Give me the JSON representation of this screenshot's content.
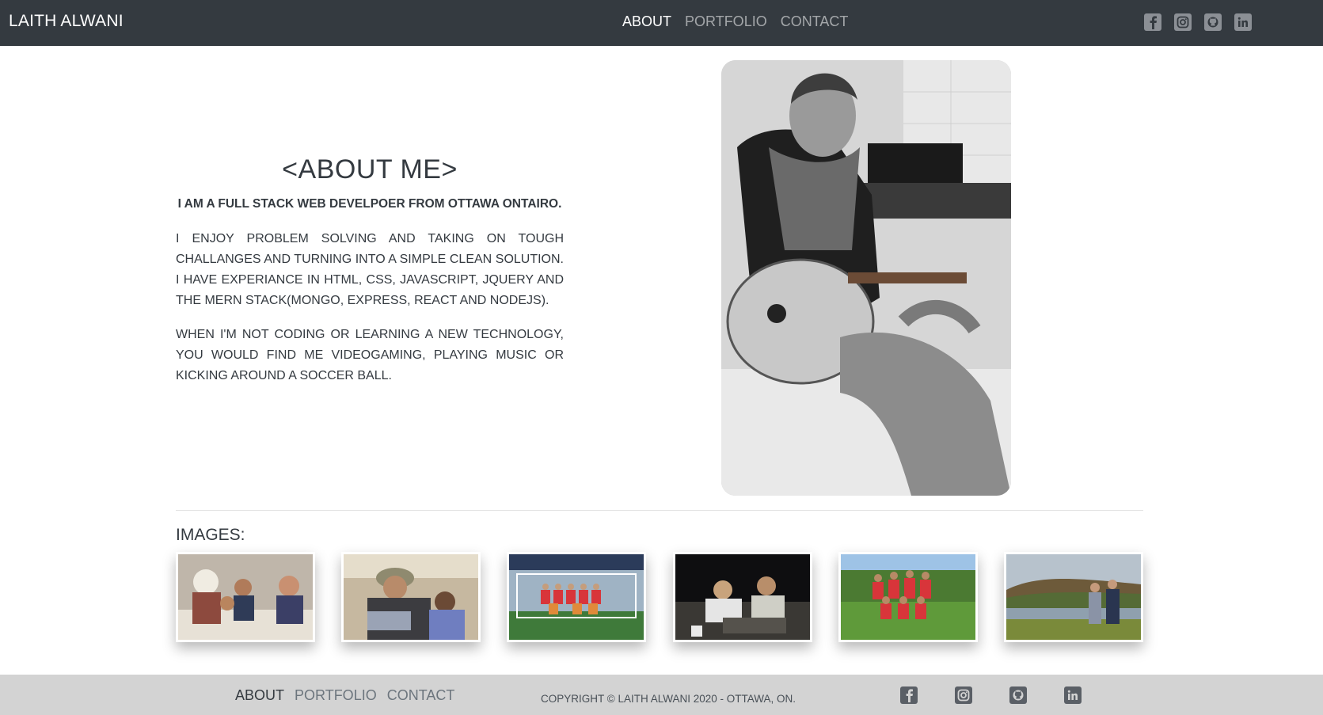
{
  "nav": {
    "brand": "LAITH ALWANI",
    "links": [
      "ABOUT",
      "PORTFOLIO",
      "CONTACT"
    ],
    "icons": [
      "facebook-icon",
      "instagram-icon",
      "github-icon",
      "linkedin-icon"
    ]
  },
  "about": {
    "title": "<ABOUT ME>",
    "subtitle": "I AM A FULL STACK WEB DEVELPOER FROM OTTAWA ONTAIRO.",
    "paragraph1": "I ENJOY PROBLEM SOLVING AND TAKING ON TOUGH CHALLANGES AND TURNING INTO A SIMPLE CLEAN SOLUTION. I HAVE EXPERIANCE IN HTML, CSS, JAVASCRIPT, JQUERY AND THE MERN STACK(MONGO, EXPRESS, REACT AND NODEJS).",
    "paragraph2": "WHEN I'M NOT CODING OR LEARNING A NEW TECHNOLOGY, YOU WOULD FIND ME VIDEOGAMING, PLAYING MUSIC OR KICKING AROUND A SOCCER BALL."
  },
  "gallery": {
    "label": "IMAGES:"
  },
  "footer": {
    "links": [
      "ABOUT",
      "PORTFOLIO",
      "CONTACT"
    ],
    "copyright": "COPYRIGHT © LAITH ALWANI 2020 - OTTAWA, ON.",
    "icons": [
      "facebook-icon",
      "instagram-icon",
      "github-icon",
      "linkedin-icon"
    ]
  },
  "colors": {
    "navbar": "#343a40",
    "footer": "#d3d3d3",
    "text": "#343a40"
  }
}
